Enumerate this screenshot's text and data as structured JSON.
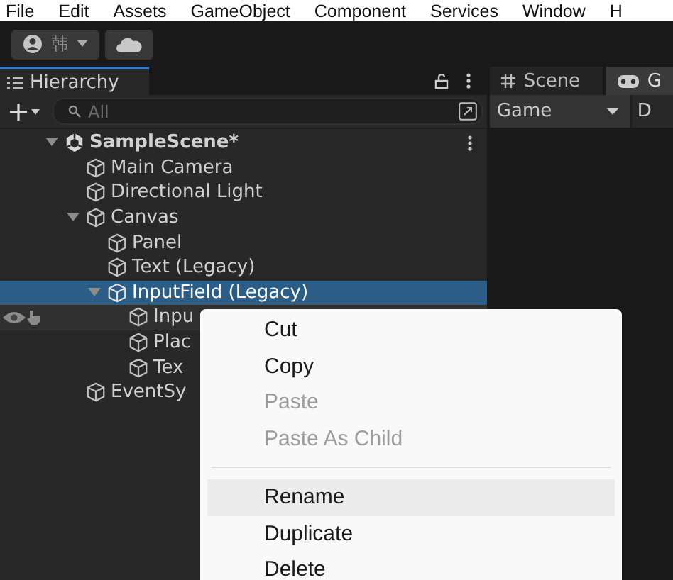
{
  "menu_bar": [
    "File",
    "Edit",
    "Assets",
    "GameObject",
    "Component",
    "Services",
    "Window",
    "H"
  ],
  "toolbar": {
    "account_label": "韩"
  },
  "hierarchy": {
    "title": "Hierarchy",
    "search": {
      "placeholder": "All"
    },
    "tree": [
      {
        "name": "SampleScene*",
        "kind": "scene",
        "expanded": true,
        "selected": false,
        "hovered": false,
        "children": [
          {
            "name": "Main Camera",
            "kind": "object",
            "selected": false,
            "hovered": false
          },
          {
            "name": "Directional Light",
            "kind": "object",
            "selected": false,
            "hovered": false
          },
          {
            "name": "Canvas",
            "kind": "object",
            "expanded": true,
            "selected": false,
            "hovered": false,
            "children": [
              {
                "name": "Panel",
                "kind": "object",
                "selected": false,
                "hovered": false
              },
              {
                "name": "Text (Legacy)",
                "kind": "object",
                "selected": false,
                "hovered": false
              },
              {
                "name": "InputField (Legacy)",
                "kind": "object",
                "expanded": true,
                "selected": true,
                "hovered": false,
                "children": [
                  {
                    "name": "Inpu",
                    "kind": "object",
                    "selected": false,
                    "hovered": true
                  },
                  {
                    "name": "Plac",
                    "kind": "object",
                    "selected": false,
                    "hovered": false
                  },
                  {
                    "name": "Tex",
                    "kind": "object",
                    "selected": false,
                    "hovered": false
                  }
                ]
              }
            ]
          },
          {
            "name": "EventSy",
            "kind": "object",
            "selected": false,
            "hovered": false
          }
        ]
      }
    ]
  },
  "right_panel": {
    "tabs": [
      {
        "label": "Scene",
        "kind": "scene",
        "selected": false
      },
      {
        "label": "G",
        "kind": "game",
        "selected": true
      }
    ],
    "view_dropdown": "Game",
    "column_2": "D"
  },
  "context_menu": [
    {
      "kind": "item",
      "label": "Cut",
      "disabled": false,
      "selected": false
    },
    {
      "kind": "item",
      "label": "Copy",
      "disabled": false,
      "selected": false
    },
    {
      "kind": "item",
      "label": "Paste",
      "disabled": true,
      "selected": false
    },
    {
      "kind": "item",
      "label": "Paste As Child",
      "disabled": true,
      "selected": false
    },
    {
      "kind": "separator"
    },
    {
      "kind": "item",
      "label": "Rename",
      "disabled": false,
      "selected": true
    },
    {
      "kind": "item",
      "label": "Duplicate",
      "disabled": false,
      "selected": false
    },
    {
      "kind": "item",
      "label": "Delete",
      "disabled": false,
      "selected": false
    }
  ]
}
